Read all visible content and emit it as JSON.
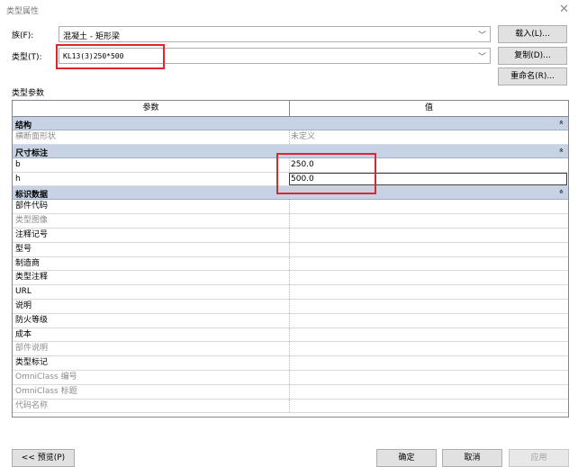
{
  "window": {
    "title": "类型属性",
    "close_glyph": "✕"
  },
  "family": {
    "label": "族(F):",
    "value": "混凝土 - 矩形梁",
    "load_button": "载入(L)..."
  },
  "type": {
    "label": "类型(T):",
    "value": "KL13(3)250*500",
    "duplicate_button": "复制(D)...",
    "rename_button": "重命名(R)..."
  },
  "section_label": "类型参数",
  "grid": {
    "header": {
      "param": "参数",
      "value": "值"
    },
    "groups": [
      {
        "name": "结构",
        "collapse": "»",
        "rows": [
          {
            "param": "横断面形状",
            "value": "未定义",
            "dim": true
          }
        ]
      },
      {
        "name": "尺寸标注",
        "collapse": "»",
        "rows": [
          {
            "param": "b",
            "value": "250.0",
            "dim": false
          },
          {
            "param": "h",
            "value": "500.0",
            "dim": false,
            "editing": true
          }
        ]
      },
      {
        "name": "标识数据",
        "collapse": "»",
        "rows": [
          {
            "param": "部件代码",
            "value": "",
            "dim": false
          },
          {
            "param": "类型图像",
            "value": "",
            "dim": true
          },
          {
            "param": "注释记号",
            "value": "",
            "dim": false
          },
          {
            "param": "型号",
            "value": "",
            "dim": false
          },
          {
            "param": "制造商",
            "value": "",
            "dim": false
          },
          {
            "param": "类型注释",
            "value": "",
            "dim": false
          },
          {
            "param": "URL",
            "value": "",
            "dim": false
          },
          {
            "param": "说明",
            "value": "",
            "dim": false
          },
          {
            "param": "防火等级",
            "value": "",
            "dim": false
          },
          {
            "param": "成本",
            "value": "",
            "dim": false
          },
          {
            "param": "部件说明",
            "value": "",
            "dim": true
          },
          {
            "param": "类型标记",
            "value": "",
            "dim": false
          },
          {
            "param": "OmniClass 编号",
            "value": "",
            "dim": true
          },
          {
            "param": "OmniClass 标题",
            "value": "",
            "dim": true
          },
          {
            "param": "代码名称",
            "value": "",
            "dim": true
          }
        ]
      }
    ]
  },
  "footer": {
    "preview_button": "<< 预览(P)",
    "ok_button": "确定",
    "cancel_button": "取消",
    "apply_button": "应用"
  },
  "colors": {
    "highlight_box": "#e0262d",
    "group_header": "#c7d3e4"
  }
}
